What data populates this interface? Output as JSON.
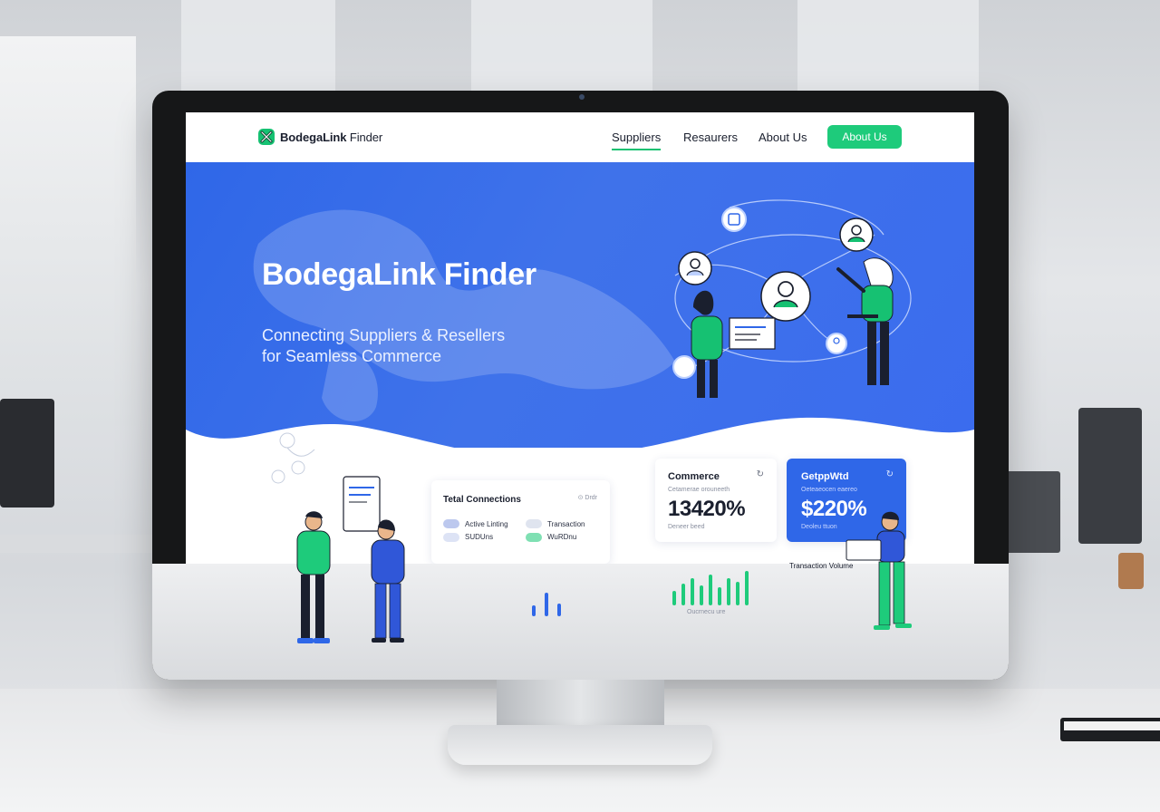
{
  "brand": {
    "name_bold": "BodegaLink",
    "name_rest": " Finder",
    "logo_color": "#16c172"
  },
  "nav": {
    "items": [
      {
        "label": "Suppliers",
        "active": true
      },
      {
        "label": "Resaurers",
        "active": false
      },
      {
        "label": "About Us",
        "active": false
      }
    ],
    "cta_label": "About Us"
  },
  "hero": {
    "title": "BodegaLink Finder",
    "subtitle_line1": "Connecting Suppliers & Resellers",
    "subtitle_line2": "for Seamless Commerce"
  },
  "connections_card": {
    "title": "Tetal Connections",
    "corner": "⊙ Drdr",
    "legend": [
      {
        "label": "Active Linting",
        "color": "#bcc8ee"
      },
      {
        "label": "Transaction",
        "color": "#dfe4ef"
      },
      {
        "label": "SUDUns",
        "color": "#dde3f5"
      },
      {
        "label": "WuRDnu",
        "color": "#7fe0b3"
      }
    ]
  },
  "commerce_card": {
    "label": "Commerce",
    "sub": "Cetamerae orouneeth",
    "value": "13420%",
    "caption": "Deneer beed"
  },
  "growth_card": {
    "label": "GetppWtd",
    "sub": "Oeteaeocen eaereo",
    "value": "$220%",
    "caption": "Deoleu ttuon"
  },
  "transaction_volume_label": "Transaction Volume",
  "chart_caption": "Oucrnecu ure",
  "colors": {
    "primary_blue": "#2f67e8",
    "accent_green": "#1ecb7b",
    "dark_text": "#1a1f2e"
  }
}
